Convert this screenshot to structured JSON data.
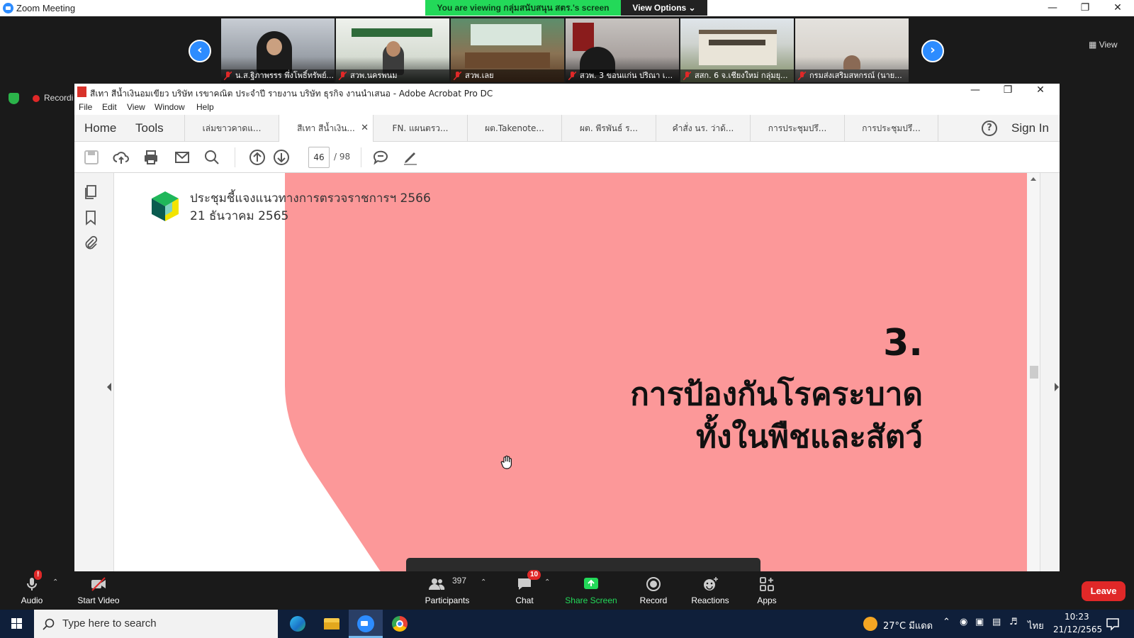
{
  "zoom": {
    "window_title": "Zoom Meeting",
    "viewing_banner": "You are viewing กลุ่มสนับสนุน สตร.'s screen",
    "view_options": "View Options ⌄",
    "view_button": "View",
    "recording_label": "Recordi"
  },
  "gallery": {
    "participants": [
      {
        "name": "น.ส.ฐิภาพรรร พึ่งโพธิ์ทรัพย์..."
      },
      {
        "name": "สวพ.นครพนม"
      },
      {
        "name": "สวพ.เลย"
      },
      {
        "name": "สวพ. 3 ขอนแก่น ปริณา เ..."
      },
      {
        "name": "สสก. 6 จ.เชียงใหม่ กลุ่มยุ..."
      },
      {
        "name": "กรมส่งเสริมสหกรณ์ (นาย..."
      }
    ]
  },
  "acrobat": {
    "window_title": "สีเทา สีน้ำเงินอมเขียว บริษัท เรขาคณิต ประจำปี รายงาน บริษัท ธุรกิจ งานนำเสนอ - Adobe Acrobat Pro DC",
    "menu": [
      "File",
      "Edit",
      "View",
      "Window",
      "Help"
    ],
    "home_label": "Home",
    "tools_label": "Tools",
    "tabs": [
      {
        "label": "เล่มขาวคาดแ..."
      },
      {
        "label": "สีเทา สีน้ำเงิน..."
      },
      {
        "label": "FN. แผนตรว..."
      },
      {
        "label": "ผต.Takenote..."
      },
      {
        "label": "ผต. พีรพันธ์ ร..."
      },
      {
        "label": "คำสั่ง นร. ว่าด้..."
      },
      {
        "label": "การประชุมปรึ..."
      },
      {
        "label": "การประชุมปรึ..."
      }
    ],
    "sign_in": "Sign In",
    "help_glyph": "?",
    "current_page": "46",
    "total_pages": "/ 98"
  },
  "document": {
    "header_line1": "ประชุมชี้แจงแนวทางการตรวจราชการฯ 2566",
    "header_line2": "21 ธันวาคม 2565",
    "slide_number": "3.",
    "slide_title_line1": "การป้องกันโรคระบาด",
    "slide_title_line2": "ทั้งในพืชและสัตว์",
    "pink_color": "#fc9899",
    "logo_colors": [
      "#1fb75a",
      "#0a5b4f",
      "#f2e400",
      "#7dd3c0"
    ]
  },
  "controls": {
    "audio": "Audio",
    "start_video": "Start Video",
    "participants": "Participants",
    "participant_count": "397",
    "chat": "Chat",
    "chat_badge": "10",
    "share_screen": "Share Screen",
    "record": "Record",
    "reactions": "Reactions",
    "apps": "Apps",
    "leave": "Leave",
    "audio_badge": "!"
  },
  "taskbar": {
    "search_placeholder": "Type here to search",
    "weather": "27°C มีแดด",
    "language": "ไทย",
    "time": "10:23",
    "date": "21/12/2565"
  }
}
